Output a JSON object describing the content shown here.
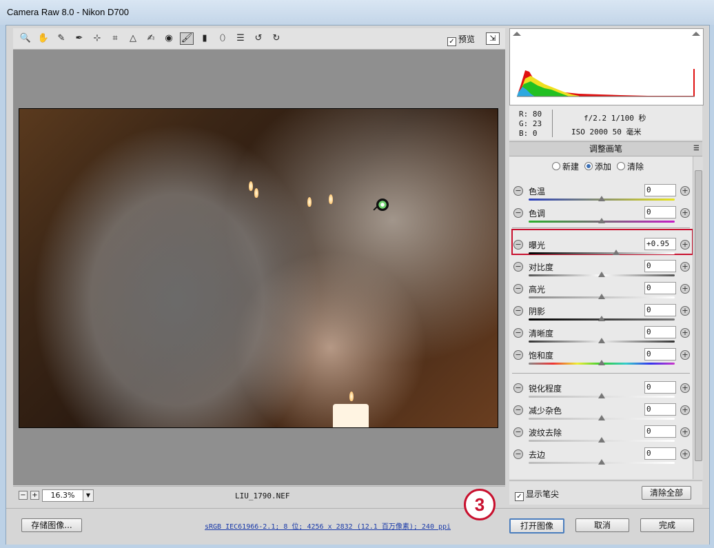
{
  "window": {
    "title": "Camera Raw 8.0 -  Nikon D700"
  },
  "toolbar": {
    "tools": [
      {
        "name": "zoom-tool-icon",
        "glyph": "🔍"
      },
      {
        "name": "hand-tool-icon",
        "glyph": "✋"
      },
      {
        "name": "white-balance-tool-icon",
        "glyph": "✎"
      },
      {
        "name": "color-sampler-tool-icon",
        "glyph": "✒"
      },
      {
        "name": "targeted-adjustment-tool-icon",
        "glyph": "⊹"
      },
      {
        "name": "crop-tool-icon",
        "glyph": "⌗"
      },
      {
        "name": "straighten-tool-icon",
        "glyph": "△"
      },
      {
        "name": "spot-removal-tool-icon",
        "glyph": "✍"
      },
      {
        "name": "red-eye-removal-tool-icon",
        "glyph": "◉"
      },
      {
        "name": "adjustment-brush-tool-icon",
        "glyph": "🖌"
      },
      {
        "name": "graduated-filter-tool-icon",
        "glyph": "▮"
      },
      {
        "name": "radial-filter-tool-icon",
        "glyph": "⬯"
      },
      {
        "name": "preferences-icon",
        "glyph": "☰"
      },
      {
        "name": "rotate-left-icon",
        "glyph": "↺"
      },
      {
        "name": "rotate-right-icon",
        "glyph": "↻"
      }
    ],
    "preview_label": "预览"
  },
  "status": {
    "zoom_minus": "−",
    "zoom_plus": "+",
    "zoom_value": "16.3%",
    "filename": "LIU_1790.NEF"
  },
  "info": {
    "r": "R:  80",
    "g": "G:  23",
    "b": "B:   0",
    "exif1": "f/2.2  1/100 秒",
    "exif2": "ISO 2000  50 毫米"
  },
  "panel": {
    "title": "调整画笔",
    "radios": [
      {
        "label": "新建",
        "selected": false
      },
      {
        "label": "添加",
        "selected": true
      },
      {
        "label": "清除",
        "selected": false
      }
    ],
    "sliders": [
      {
        "label": "色温",
        "value": "0",
        "pos": 0.5,
        "track": "linear-gradient(90deg,#2a3fbf,#e8e41c)"
      },
      {
        "label": "色调",
        "value": "0",
        "pos": 0.5,
        "track": "linear-gradient(90deg,#2bb02b,#c51fc5)"
      },
      {
        "label": "曝光",
        "value": "+0.95",
        "pos": 0.6,
        "track": "linear-gradient(90deg,#000,#fff)"
      },
      {
        "label": "对比度",
        "value": "0",
        "pos": 0.5,
        "track": "linear-gradient(90deg,#555,#fff,#555)"
      },
      {
        "label": "高光",
        "value": "0",
        "pos": 0.5,
        "track": "linear-gradient(90deg,#888,#fff)"
      },
      {
        "label": "阴影",
        "value": "0",
        "pos": 0.5,
        "track": "linear-gradient(90deg,#000,#777)"
      },
      {
        "label": "清晰度",
        "value": "0",
        "pos": 0.5,
        "track": "linear-gradient(90deg,#333,#eee,#333)"
      },
      {
        "label": "饱和度",
        "value": "0",
        "pos": 0.5,
        "track": "linear-gradient(90deg,#888,#e33,#ee3,#3c3,#3cc,#33e,#c3c)"
      },
      {
        "label": "锐化程度",
        "value": "0",
        "pos": 0.5,
        "track": "linear-gradient(90deg,#bbb,#fff)"
      },
      {
        "label": "减少杂色",
        "value": "0",
        "pos": 0.5,
        "track": "linear-gradient(90deg,#bbb,#fff)"
      },
      {
        "label": "波纹去除",
        "value": "0",
        "pos": 0.5,
        "track": "linear-gradient(90deg,#bbb,#fff)"
      },
      {
        "label": "去边",
        "value": "0",
        "pos": 0.5,
        "track": "linear-gradient(90deg,#bbb,#fff)"
      }
    ],
    "show_tip_label": "显示笔尖",
    "clear_all_label": "清除全部"
  },
  "bottom": {
    "save_label": "存储图像...",
    "workflow_link": "sRGB IEC61966-2.1; 8 位; 4256 x 2832 (12.1 百万像素); 240 ppi",
    "open_label": "打开图像",
    "cancel_label": "取消",
    "done_label": "完成",
    "step_badge": "3"
  },
  "colors": {
    "highlight": "#c8102e",
    "accent": "#3a6fb5"
  }
}
